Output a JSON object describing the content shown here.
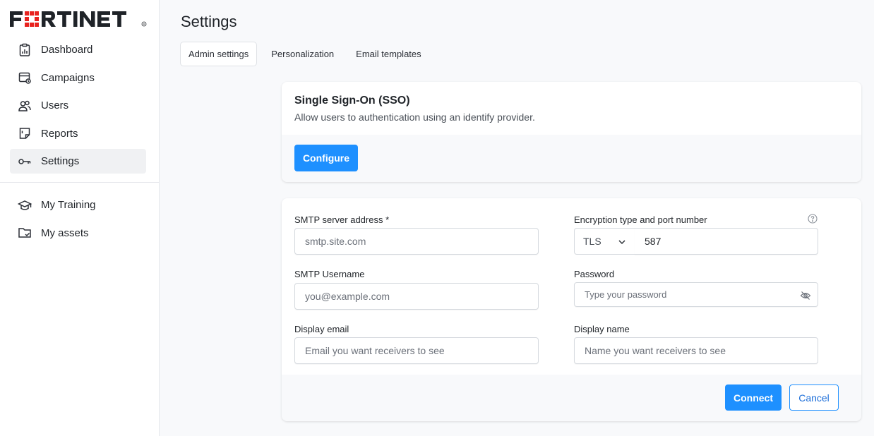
{
  "brand": {
    "logo_text": "FORTINET",
    "color": "#e8231f"
  },
  "sidebar": {
    "items": [
      {
        "label": "Dashboard",
        "icon": "dashboard-icon"
      },
      {
        "label": "Campaigns",
        "icon": "campaigns-icon"
      },
      {
        "label": "Users",
        "icon": "users-icon"
      },
      {
        "label": "Reports",
        "icon": "reports-icon"
      },
      {
        "label": "Settings",
        "icon": "key-icon",
        "active": true
      }
    ],
    "secondary_items": [
      {
        "label": "My Training",
        "icon": "graduation-cap-icon"
      },
      {
        "label": "My assets",
        "icon": "folder-check-icon"
      }
    ]
  },
  "page": {
    "title": "Settings"
  },
  "tabs": [
    {
      "label": "Admin settings",
      "active": true
    },
    {
      "label": "Personalization"
    },
    {
      "label": "Email templates"
    }
  ],
  "sso": {
    "title": "Single Sign-On (SSO)",
    "subtitle": "Allow users to authentication using an identify provider.",
    "configure_label": "Configure"
  },
  "smtp": {
    "server_label": "SMTP server address *",
    "server_placeholder": "smtp.site.com",
    "encryption_label": "Encryption type and port number",
    "encryption_value": "TLS",
    "port_value": "587",
    "username_label": "SMTP Username",
    "username_placeholder": "you@example.com",
    "password_label": "Password",
    "password_placeholder": "Type your password",
    "display_email_label": "Display email",
    "display_email_placeholder": "Email you want receivers to see",
    "display_name_label": "Display name",
    "display_name_placeholder": "Name you want receivers to see",
    "connect_label": "Connect",
    "cancel_label": "Cancel"
  },
  "colors": {
    "accent": "#1e90ff",
    "brand_red": "#e8231f"
  }
}
